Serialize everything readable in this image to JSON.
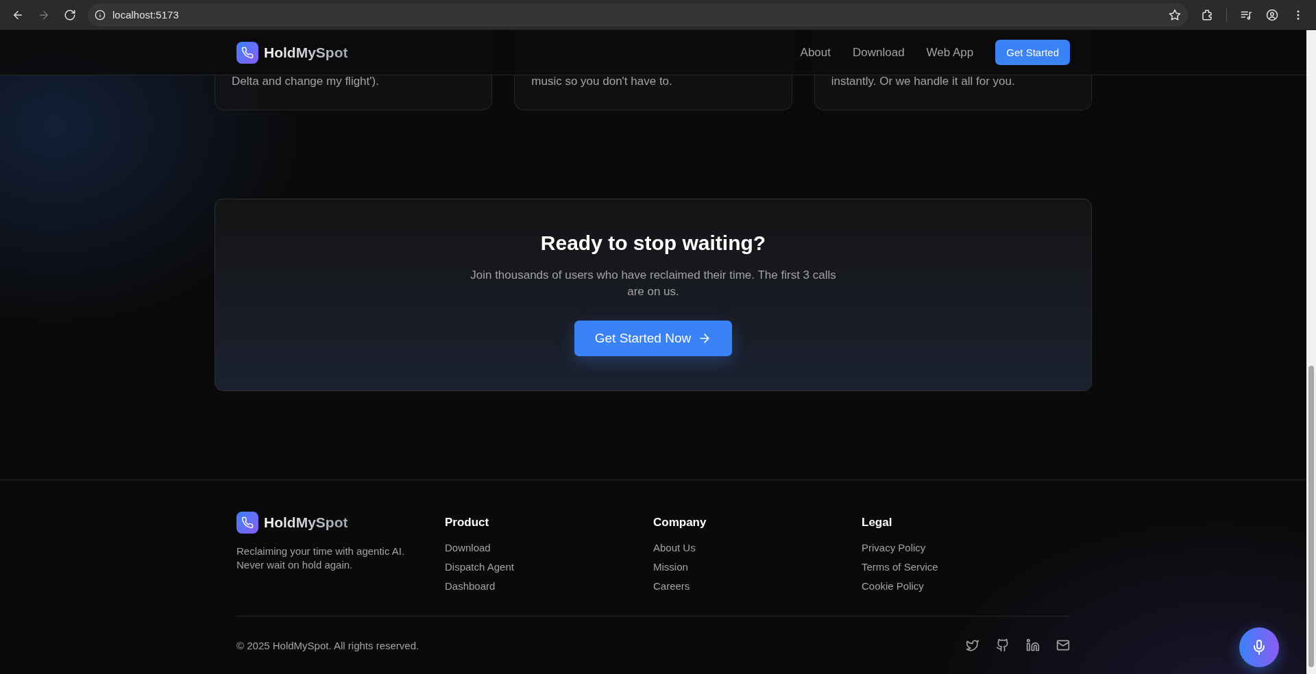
{
  "browser": {
    "address": "localhost:5173"
  },
  "header": {
    "brand": "HoldMySpot",
    "nav": [
      "About",
      "Download",
      "Web App"
    ],
    "cta": "Get Started"
  },
  "feature_cards": [
    {
      "text": "Delta and change my flight')."
    },
    {
      "text": "music so you don't have to."
    },
    {
      "text": "instantly. Or we handle it all for you."
    }
  ],
  "cta_section": {
    "title": "Ready to stop waiting?",
    "subtitle": "Join thousands of users who have reclaimed their time. The first 3 calls are on us.",
    "button": "Get Started Now"
  },
  "footer": {
    "brand": "HoldMySpot",
    "tagline": "Reclaiming your time with agentic AI. Never wait on hold again.",
    "columns": [
      {
        "title": "Product",
        "links": [
          "Download",
          "Dispatch Agent",
          "Dashboard"
        ]
      },
      {
        "title": "Company",
        "links": [
          "About Us",
          "Mission",
          "Careers"
        ]
      },
      {
        "title": "Legal",
        "links": [
          "Privacy Policy",
          "Terms of Service",
          "Cookie Policy"
        ]
      }
    ],
    "copyright": "© 2025 HoldMySpot. All rights reserved.",
    "social": [
      {
        "kind": "twitter"
      },
      {
        "kind": "github"
      },
      {
        "kind": "linkedin"
      },
      {
        "kind": "mail"
      }
    ]
  }
}
